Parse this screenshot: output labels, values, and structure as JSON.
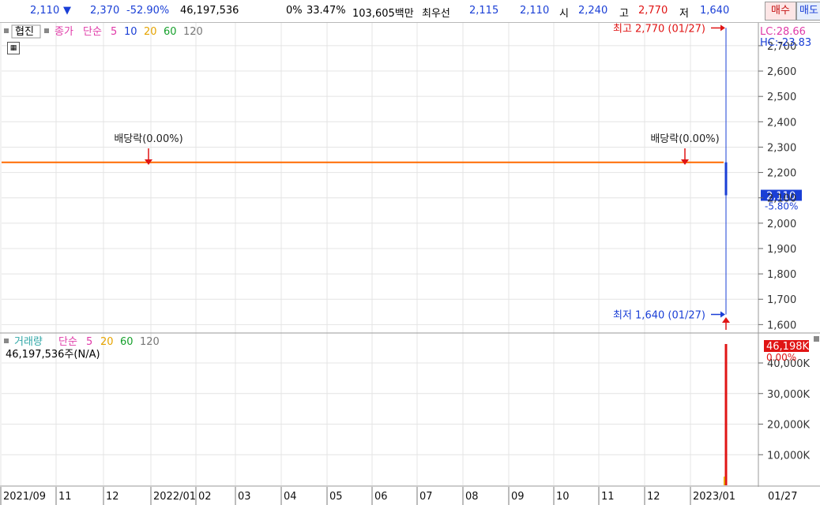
{
  "ticker": {
    "price": "2,110",
    "change_arrow": "▼",
    "change": "2,370",
    "change_pct": "-52.90%",
    "volume": "46,197,536",
    "ratio1": "0%",
    "ratio2": "33.47%",
    "trade_value": "103,605백만",
    "best_label": "최우선",
    "best_ask": "2,115",
    "best_bid": "2,110",
    "open_label": "시",
    "open": "2,240",
    "high_label": "고",
    "high": "2,770",
    "low_label": "저",
    "low": "1,640",
    "buy_label": "매수",
    "sell_label": "매도"
  },
  "colors": {
    "price_line": "#ff6a00",
    "candle_blue": "#1a3fd6",
    "volume_bar": "#e01414",
    "grid": "#e4e4e4",
    "current_price_bg": "#1a3fd6",
    "current_volume_bg": "#e01414"
  },
  "chart_data": [
    {
      "type": "line",
      "panel": "price",
      "legend": {
        "hyupjin": "협진",
        "close": "종가",
        "simple": "단순",
        "ma": [
          "5",
          "10",
          "20",
          "60",
          "120"
        ]
      },
      "lc_label": "LC:28.66",
      "hc_label": "HC:-23.83",
      "ylim": [
        1570,
        2790
      ],
      "y_ticks": [
        1600,
        1700,
        1800,
        1900,
        2000,
        2100,
        2200,
        2300,
        2400,
        2500,
        2600,
        2700
      ],
      "y_tick_labels": [
        "1,600",
        "1,700",
        "1,800",
        "1,900",
        "2,000",
        "2,100",
        "2,200",
        "2,300",
        "2,400",
        "2,500",
        "2,600",
        "2,700"
      ],
      "flat_close": 2240,
      "last_candle": {
        "date": "01/27",
        "open": 2240,
        "high": 2770,
        "low": 1640,
        "close": 2110
      },
      "current_price_label": "2,110",
      "current_change_label": "-5.80%",
      "high_annotation": "최고 2,770 (01/27)",
      "low_annotation": "최저 1,640 (01/27)",
      "dividend_label": "배당락(0.00%)",
      "dividend_marks": [
        "2021/12",
        "2023/01"
      ]
    },
    {
      "type": "bar",
      "panel": "volume",
      "legend": {
        "volume": "거래량",
        "simple": "단순",
        "ma": [
          "5",
          "20",
          "60",
          "120"
        ]
      },
      "volume_text": "46,197,536주(N/A)",
      "ylim": [
        0,
        48000
      ],
      "y_ticks": [
        10000,
        20000,
        30000,
        40000
      ],
      "y_tick_labels": [
        "10,000K",
        "20,000K",
        "30,000K",
        "40,000K"
      ],
      "last_volume_k": 46198,
      "current_volume_label": "46,198K",
      "current_volume_pct": "0.00%"
    }
  ],
  "x_axis": {
    "labels": [
      "2021/09",
      "11",
      "12",
      "2022/01",
      "02",
      "03",
      "04",
      "05",
      "06",
      "07",
      "08",
      "09",
      "10",
      "11",
      "12",
      "2023/01"
    ],
    "right_label": "01/27"
  }
}
